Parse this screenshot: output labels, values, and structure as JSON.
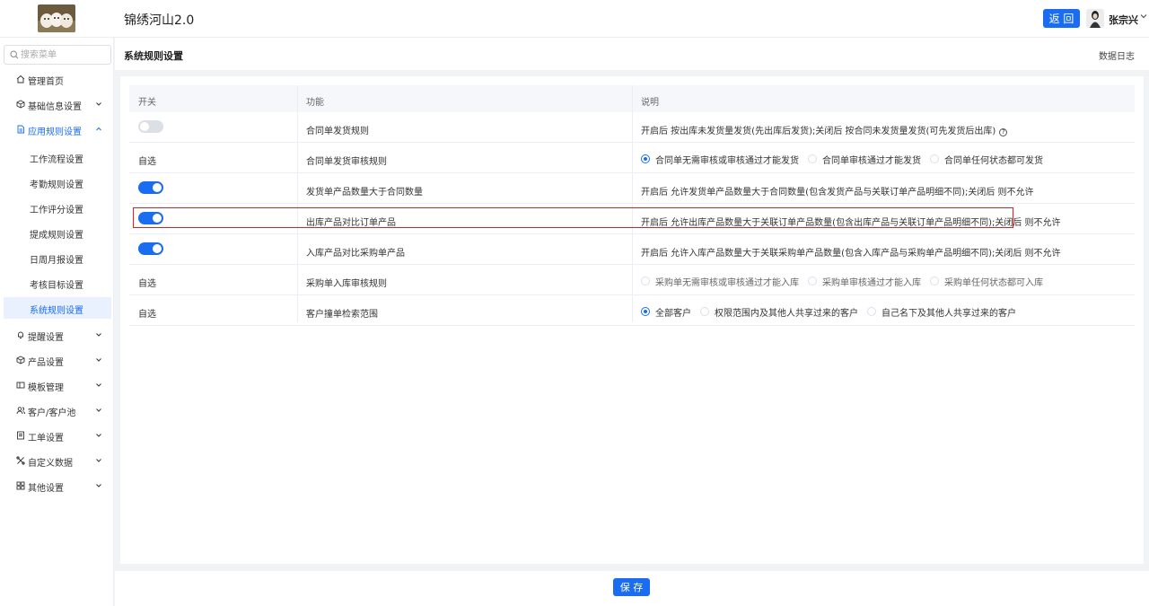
{
  "header": {
    "app_title": "锦绣河山2.0",
    "return_label": "返 回",
    "username": "张宗兴"
  },
  "sidebar": {
    "search_placeholder": "搜索菜单",
    "items": [
      {
        "label": "管理首页",
        "icon": "home-icon"
      },
      {
        "label": "基础信息设置",
        "icon": "box-icon"
      },
      {
        "label": "应用规则设置",
        "icon": "document-icon",
        "expanded": true
      },
      {
        "label": "提醒设置",
        "icon": "bell-icon"
      },
      {
        "label": "产品设置",
        "icon": "cube-icon"
      },
      {
        "label": "模板管理",
        "icon": "template-icon"
      },
      {
        "label": "客户/客户池",
        "icon": "users-icon"
      },
      {
        "label": "工单设置",
        "icon": "ticket-icon"
      },
      {
        "label": "自定义数据",
        "icon": "custom-data-icon"
      },
      {
        "label": "其他设置",
        "icon": "grid-icon"
      }
    ],
    "sub_items": [
      "工作流程设置",
      "考勤规则设置",
      "工作评分设置",
      "提成规则设置",
      "日周月报设置",
      "考核目标设置",
      "系统规则设置"
    ],
    "selected_sub": "系统规则设置"
  },
  "main": {
    "page_title": "系统规则设置",
    "data_log": "数据日志",
    "columns": [
      "开关",
      "功能",
      "说明"
    ],
    "rows": [
      {
        "switch": "off",
        "name": "合同单发货规则",
        "desc": "开启后 按出库未发货量发货(先出库后发货);关闭后 按合同未发货量发货(可先发货后出库)",
        "help": true
      },
      {
        "switch": "自选",
        "name": "合同单发货审核规则",
        "options": [
          "合同单无需审核或审核通过才能发货",
          "合同单审核通过才能发货",
          "合同单任何状态都可发货"
        ],
        "selected": 0
      },
      {
        "switch": "on",
        "name": "发货单产品数量大于合同数量",
        "desc": "开启后 允许发货单产品数量大于合同数量(包含发货产品与关联订单产品明细不同);关闭后 则不允许"
      },
      {
        "switch": "on",
        "name": "出库产品对比订单产品",
        "desc": "开启后 允许出库产品数量大于关联订单产品数量(包含出库产品与关联订单产品明细不同);关闭后 则不允许"
      },
      {
        "switch": "on",
        "name": "入库产品对比采购单产品",
        "desc": "开启后 允许入库产品数量大于关联采购单产品数量(包含入库产品与采购单产品明细不同);关闭后 则不允许"
      },
      {
        "switch": "自选",
        "name": "采购单入库审核规则",
        "options": [
          "采购单无需审核或审核通过才能入库",
          "采购单审核通过才能入库",
          "采购单任何状态都可入库"
        ],
        "selected": -1
      },
      {
        "switch": "自选",
        "name": "客户撞单检索范围",
        "options": [
          "全部客户",
          "权限范围内及其他人共享过来的客户",
          "自己名下及其他人共享过来的客户"
        ],
        "selected": 0
      }
    ]
  },
  "footer": {
    "save_label": "保 存"
  },
  "colors": {
    "accent": "#1a6cf0",
    "highlight": "#e02020"
  }
}
